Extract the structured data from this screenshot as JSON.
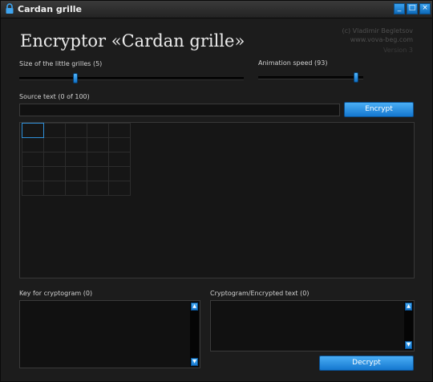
{
  "window": {
    "title": "Cardan grille",
    "controls": {
      "minimize": "_",
      "maximize": "□",
      "close": "×"
    }
  },
  "header": {
    "title": "Encryptor «Cardan grille»",
    "credit_line1": "(c) Vladimir Begletsov",
    "credit_line2": "www.vova-beg.com",
    "version": "Version 3"
  },
  "grille_size": {
    "label": "Size of the little grilles (5)",
    "value": 5,
    "level": 0.25
  },
  "animation_speed": {
    "label": "Animation speed (93)",
    "value": 93,
    "level": 0.93
  },
  "source": {
    "label": "Source text (0 of 100)",
    "value": ""
  },
  "encrypt_button": {
    "label": "Encrypt"
  },
  "key": {
    "label": "Key for cryptogram (0)",
    "value": ""
  },
  "cryptogram": {
    "label": "Cryptogram/Encrypted text (0)",
    "value": ""
  },
  "decrypt_button": {
    "label": "Decrypt"
  },
  "scroll_arrows": {
    "up": "▲",
    "down": "▼"
  },
  "colors": {
    "accent": "#1a7fd6",
    "background": "#1c1c1c"
  }
}
